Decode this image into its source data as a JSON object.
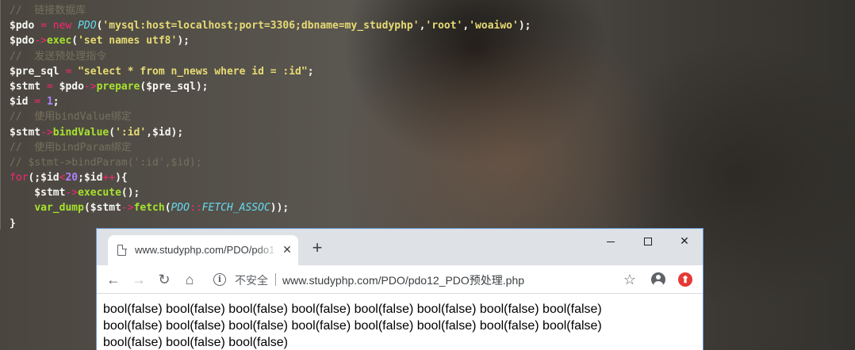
{
  "editor": {
    "lines": [
      [
        {
          "t": "//  链接数据库",
          "c": "c-cm"
        }
      ],
      [
        {
          "t": "$pdo",
          "c": "c-var"
        },
        {
          "t": " = ",
          "c": "c-op"
        },
        {
          "t": "new ",
          "c": "c-kw"
        },
        {
          "t": "PDO",
          "c": "c-cls"
        },
        {
          "t": "(",
          "c": "c-pl"
        },
        {
          "t": "'mysql:host=localhost;port=3306;dbname=my_studyphp'",
          "c": "c-str"
        },
        {
          "t": ",",
          "c": "c-pl"
        },
        {
          "t": "'root'",
          "c": "c-str"
        },
        {
          "t": ",",
          "c": "c-pl"
        },
        {
          "t": "'woaiwo'",
          "c": "c-str"
        },
        {
          "t": ");",
          "c": "c-pl"
        }
      ],
      [
        {
          "t": "$pdo",
          "c": "c-var"
        },
        {
          "t": "->",
          "c": "c-op"
        },
        {
          "t": "exec",
          "c": "c-fn"
        },
        {
          "t": "(",
          "c": "c-pl"
        },
        {
          "t": "'set names utf8'",
          "c": "c-str"
        },
        {
          "t": ");",
          "c": "c-pl"
        }
      ],
      [
        {
          "t": "//  发送预处理指令",
          "c": "c-cm"
        }
      ],
      [
        {
          "t": "$pre_sql",
          "c": "c-var"
        },
        {
          "t": " = ",
          "c": "c-op"
        },
        {
          "t": "\"select * from n_news where id = :id\"",
          "c": "c-str"
        },
        {
          "t": ";",
          "c": "c-pl"
        }
      ],
      [
        {
          "t": "$stmt",
          "c": "c-var"
        },
        {
          "t": " = ",
          "c": "c-op"
        },
        {
          "t": "$pdo",
          "c": "c-var"
        },
        {
          "t": "->",
          "c": "c-op"
        },
        {
          "t": "prepare",
          "c": "c-fn"
        },
        {
          "t": "($pre_sql);",
          "c": "c-pl"
        }
      ],
      [
        {
          "t": "$id",
          "c": "c-var"
        },
        {
          "t": " = ",
          "c": "c-op"
        },
        {
          "t": "1",
          "c": "c-num"
        },
        {
          "t": ";",
          "c": "c-pl"
        }
      ],
      [
        {
          "t": "//  使用bindValue绑定",
          "c": "c-cm"
        }
      ],
      [
        {
          "t": "$stmt",
          "c": "c-var"
        },
        {
          "t": "->",
          "c": "c-op"
        },
        {
          "t": "bindValue",
          "c": "c-fn"
        },
        {
          "t": "(",
          "c": "c-pl"
        },
        {
          "t": "':id'",
          "c": "c-str"
        },
        {
          "t": ",$id);",
          "c": "c-pl"
        }
      ],
      [
        {
          "t": "//  使用bindParam绑定",
          "c": "c-cm"
        }
      ],
      [
        {
          "t": "// $stmt->bindParam(':id',$id);",
          "c": "c-cm"
        }
      ],
      [
        {
          "t": "for",
          "c": "c-kw"
        },
        {
          "t": "(;$id",
          "c": "c-pl"
        },
        {
          "t": "<",
          "c": "c-op"
        },
        {
          "t": "20",
          "c": "c-num"
        },
        {
          "t": ";$id",
          "c": "c-pl"
        },
        {
          "t": "++",
          "c": "c-op"
        },
        {
          "t": "){",
          "c": "c-pl"
        }
      ],
      [
        {
          "t": "    $stmt",
          "c": "c-var"
        },
        {
          "t": "->",
          "c": "c-op"
        },
        {
          "t": "execute",
          "c": "c-fn"
        },
        {
          "t": "();",
          "c": "c-pl"
        }
      ],
      [
        {
          "t": "    ",
          "c": "c-pl"
        },
        {
          "t": "var_dump",
          "c": "c-fn"
        },
        {
          "t": "($stmt",
          "c": "c-pl"
        },
        {
          "t": "->",
          "c": "c-op"
        },
        {
          "t": "fetch",
          "c": "c-fn"
        },
        {
          "t": "(",
          "c": "c-pl"
        },
        {
          "t": "PDO",
          "c": "c-cls"
        },
        {
          "t": "::",
          "c": "c-op"
        },
        {
          "t": "FETCH_ASSOC",
          "c": "c-cls"
        },
        {
          "t": "));",
          "c": "c-pl"
        }
      ],
      [
        {
          "t": "}",
          "c": "c-pl"
        }
      ]
    ]
  },
  "browser": {
    "tab_title": "www.studyphp.com/PDO/pdo1",
    "tab_close": "✕",
    "new_tab": "+",
    "insecure_label": "不安全",
    "url": "www.studyphp.com/PDO/pdo12_PDO预处理.php",
    "info_glyph": "i",
    "ext_glyph": "⬆",
    "content_lines": [
      "bool(false) bool(false) bool(false) bool(false) bool(false) bool(false) bool(false) bool(false)",
      "bool(false) bool(false) bool(false) bool(false) bool(false) bool(false) bool(false) bool(false)",
      "bool(false) bool(false) bool(false)"
    ]
  }
}
